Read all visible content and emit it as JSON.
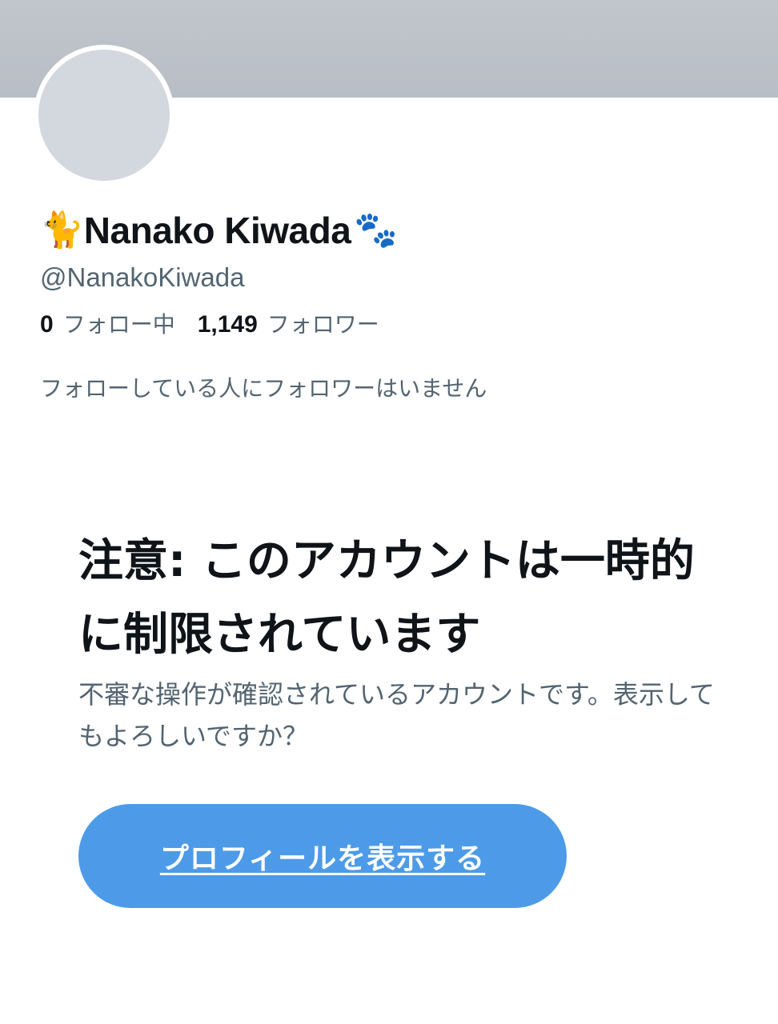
{
  "profile": {
    "name_prefix_icon": "cat-emoji",
    "name_prefix_glyph": "🐈",
    "display_name": "Nanako Kiwada",
    "name_suffix_icon": "paw-prints-emoji",
    "name_suffix_glyph": "🐾",
    "handle": "@NanakoKiwada",
    "following_count": "0",
    "following_label": "フォロー中",
    "followers_count": "1,149",
    "followers_label": "フォロワー",
    "followers_you_follow_note": "フォローしている人にフォロワーはいません"
  },
  "warning": {
    "title": "注意: このアカウントは一時的に制限されています",
    "message": "不審な操作が確認されているアカウントです。表示してもよろしいですか？",
    "button_label": "プロフィールを表示する"
  },
  "colors": {
    "banner": "#c0c6cc",
    "avatar_placeholder": "#d2d8de",
    "button": "#4d9be8",
    "secondary_text": "#536471",
    "primary_text": "#0f1419"
  }
}
